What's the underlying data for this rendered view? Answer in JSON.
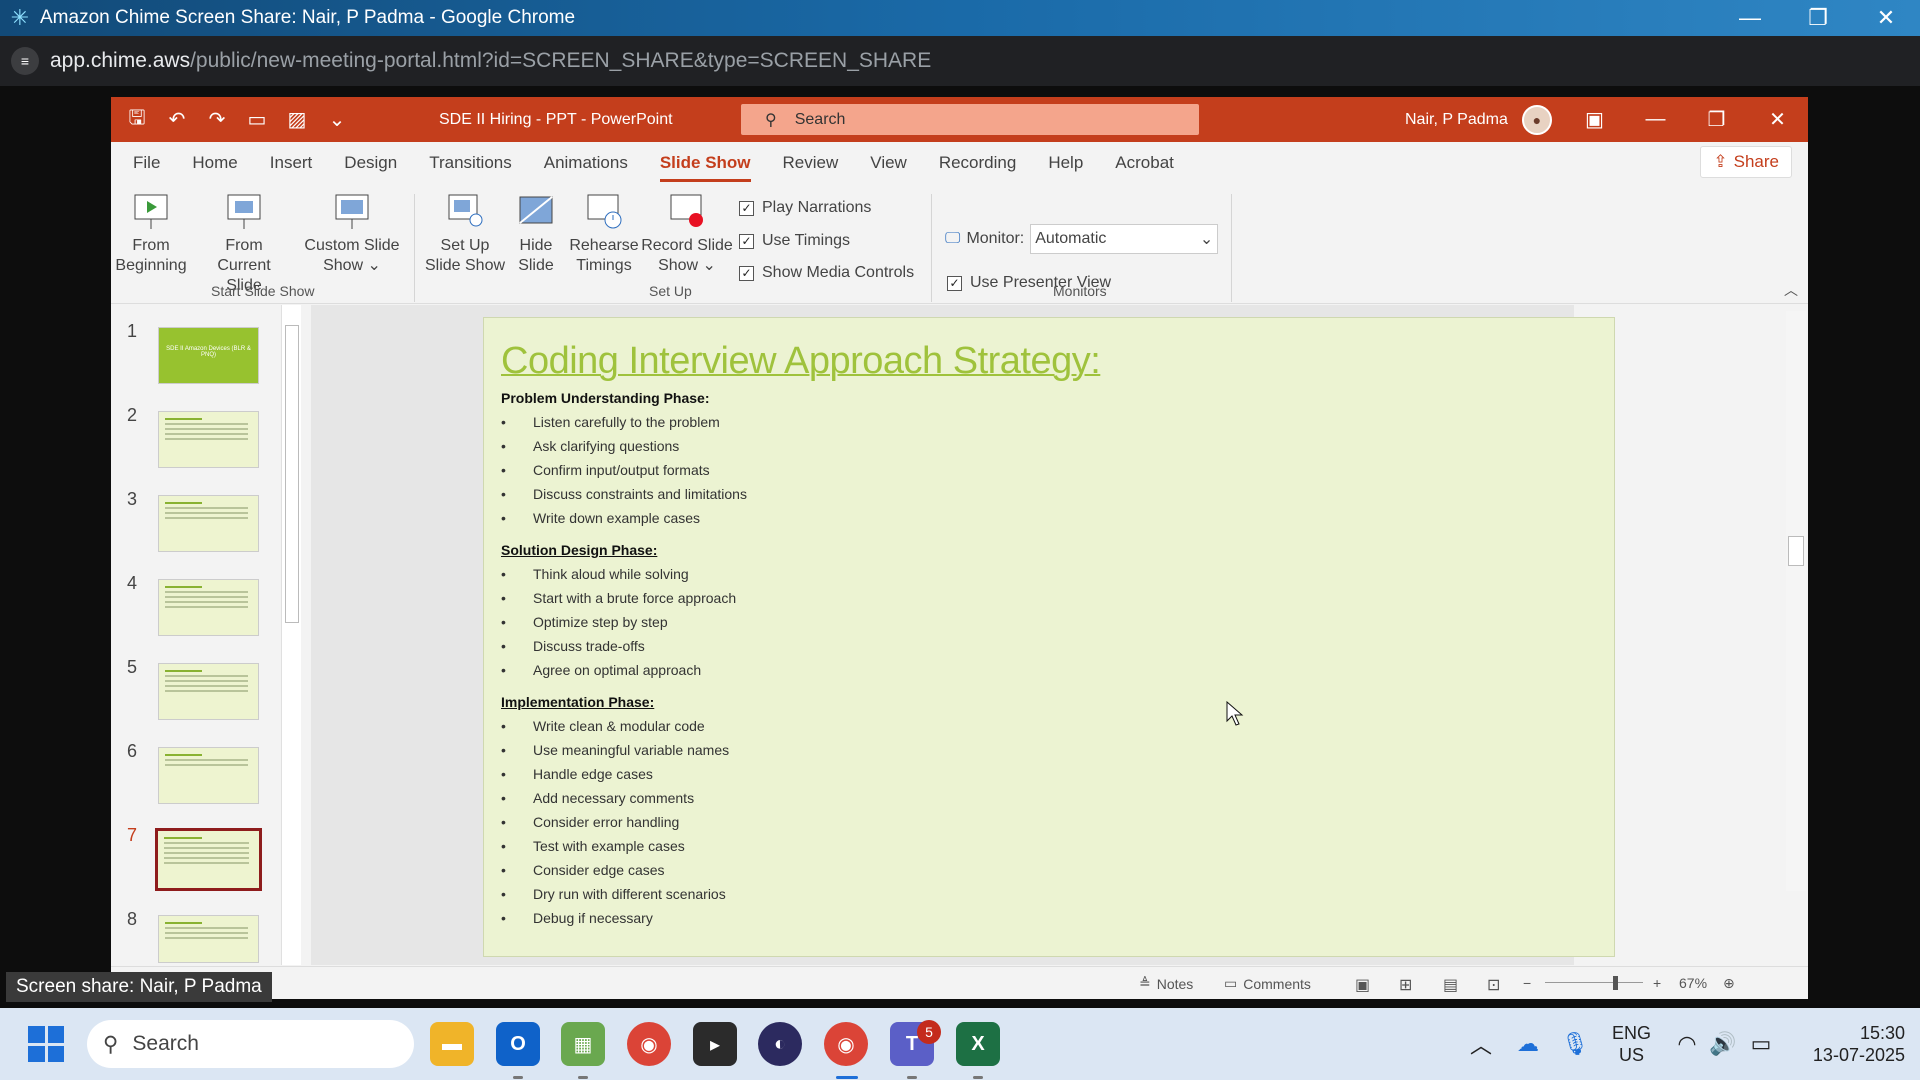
{
  "chrome": {
    "title": "Amazon Chime Screen Share: Nair, P Padma - Google Chrome",
    "url_host": "app.chime.aws",
    "url_path": "/public/new-meeting-portal.html?id=SCREEN_SHARE&type=SCREEN_SHARE"
  },
  "ppt": {
    "doc_title": "SDE II Hiring - PPT  -  PowerPoint",
    "search_placeholder": "Search",
    "user_name": "Nair, P Padma",
    "tabs": [
      "File",
      "Home",
      "Insert",
      "Design",
      "Transitions",
      "Animations",
      "Slide Show",
      "Review",
      "View",
      "Recording",
      "Help",
      "Acrobat"
    ],
    "active_tab": "Slide Show",
    "share_label": "Share",
    "ribbon": {
      "from_beginning": [
        "From",
        "Beginning"
      ],
      "from_current": [
        "From",
        "Current Slide"
      ],
      "custom_show": [
        "Custom Slide",
        "Show ⌄"
      ],
      "setup_show": [
        "Set Up",
        "Slide Show"
      ],
      "hide_slide": [
        "Hide",
        "Slide"
      ],
      "rehearse": [
        "Rehearse",
        "Timings"
      ],
      "record": [
        "Record Slide",
        "Show ⌄"
      ],
      "play_narrations": "Play Narrations",
      "use_timings": "Use Timings",
      "show_media_controls": "Show Media Controls",
      "monitor_label": "Monitor:",
      "monitor_value": "Automatic",
      "use_presenter_view": "Use Presenter View",
      "group_start": "Start Slide Show",
      "group_setup": "Set Up",
      "group_monitors": "Monitors"
    },
    "thumb_numbers": [
      "1",
      "2",
      "3",
      "4",
      "5",
      "6",
      "7",
      "8"
    ],
    "thumb1_text": "SDE II Amazon Devices (BLR & PNQ)",
    "active_slide": 7,
    "slide": {
      "title": "Coding Interview Approach Strategy:",
      "sections": [
        {
          "heading": "Problem Understanding Phase:",
          "items": [
            "Listen carefully to the problem",
            "Ask clarifying questions",
            "Confirm input/output formats",
            "Discuss constraints and limitations",
            "Write down example cases"
          ]
        },
        {
          "heading": "Solution Design Phase:",
          "items": [
            "Think aloud while solving",
            "Start with a brute force approach",
            "Optimize step by step",
            "Discuss trade-offs",
            "Agree on optimal approach"
          ]
        },
        {
          "heading": "Implementation Phase:",
          "items": [
            "Write clean & modular code",
            "Use meaningful variable names",
            "Handle edge cases",
            "Add necessary comments",
            "Consider error handling",
            "Test with example cases",
            "Consider edge cases",
            "Dry run with different scenarios",
            "Debug if necessary"
          ]
        }
      ]
    },
    "status": {
      "notes": "Notes",
      "comments": "Comments",
      "zoom": "67%"
    }
  },
  "share_label": "Screen share: Nair, P Padma",
  "taskbar": {
    "search_placeholder": "Search",
    "teams_badge": "5",
    "lang_top": "ENG",
    "lang_bottom": "US",
    "time": "15:30",
    "date": "13-07-2025"
  }
}
